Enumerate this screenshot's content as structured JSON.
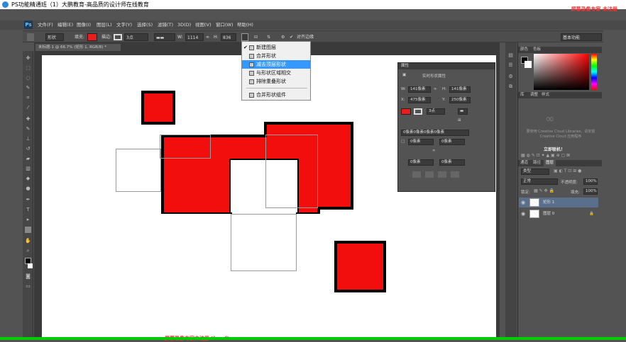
{
  "window": {
    "title": "PS功能精通班（1）大鹏教育-高品质的设计师在线教育",
    "watermark_top": "屏幕录像专家  未注册"
  },
  "menubar": {
    "logo": "Ps",
    "items": [
      "文件(F)",
      "编辑(E)",
      "图像(I)",
      "图层(L)",
      "文字(Y)",
      "选择(S)",
      "滤镜(T)",
      "3D(D)",
      "视图(V)",
      "窗口(W)",
      "帮助(H)"
    ]
  },
  "options": {
    "shape_mode": "形状",
    "fill_label": "填充:",
    "stroke_label": "描边:",
    "stroke_width": "3点",
    "w_label": "W:",
    "w_value": "1114像",
    "h_label": "H:",
    "h_value": "836像",
    "align_edges": "对齐边缘",
    "workspace": "基本功能",
    "fill_color": "#ec1c1c"
  },
  "document": {
    "tab": "未标题-1 @ 66.7% (矩形 1, RGB/8) *"
  },
  "dropdown": {
    "items": [
      {
        "label": "新建图层",
        "checked": true
      },
      {
        "label": "合并形状",
        "checked": false
      },
      {
        "label": "减去顶层形状",
        "checked": false,
        "selected": true
      },
      {
        "label": "与形状区域相交",
        "checked": false
      },
      {
        "label": "排除重叠形状",
        "checked": false
      },
      {
        "label": "合并形状组件",
        "checked": false
      }
    ]
  },
  "properties": {
    "tab": "属性",
    "title": "实时形状属性",
    "w_label": "W:",
    "w_value": "141像素",
    "h_label": "H:",
    "h_value": "141像素",
    "x_label": "X:",
    "x_value": "475像素",
    "y_label": "Y:",
    "y_value": "250像素",
    "stroke_width": "3点",
    "corner_all": "0像素0像素0像素0像素",
    "corner_tl": "0像素",
    "corner_tr": "0像素",
    "corner_bl": "0像素",
    "corner_br": "0像素"
  },
  "color_panel": {
    "tabs": [
      "颜色",
      "色板"
    ]
  },
  "library_panel": {
    "tabs": [
      "库",
      "调整",
      "样式"
    ],
    "message": "要使用 Creative Cloud Libraries，请安装 Creative Cloud 应用程序",
    "link": "立即联机！"
  },
  "layers_panel": {
    "tabs": [
      "通道",
      "路径",
      "图层"
    ],
    "kind": "类型",
    "blend_mode": "正常",
    "opacity_label": "不透明度:",
    "opacity": "100%",
    "lock_label": "锁定:",
    "fill_label": "填充:",
    "fill": "100%",
    "layers": [
      {
        "name": "矩形 1",
        "selected": true
      },
      {
        "name": "图层 0",
        "selected": false
      }
    ]
  },
  "bottom_watermark": "屏幕录像专家未注册 tlxsoft.com"
}
